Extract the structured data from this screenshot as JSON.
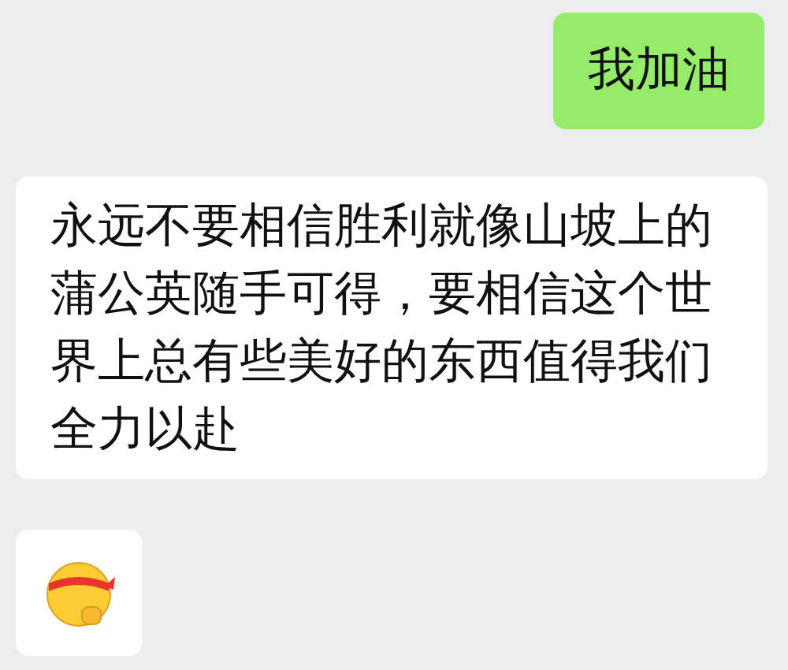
{
  "messages": [
    {
      "sent": true,
      "kind": "text",
      "text": "我加油"
    },
    {
      "sent": false,
      "kind": "text",
      "text": "永远不要相信胜利就像山坡上的蒲公英随手可得，要相信这个世界上总有些美好的东西值得我们全力以赴"
    },
    {
      "sent": false,
      "kind": "emoji"
    }
  ]
}
